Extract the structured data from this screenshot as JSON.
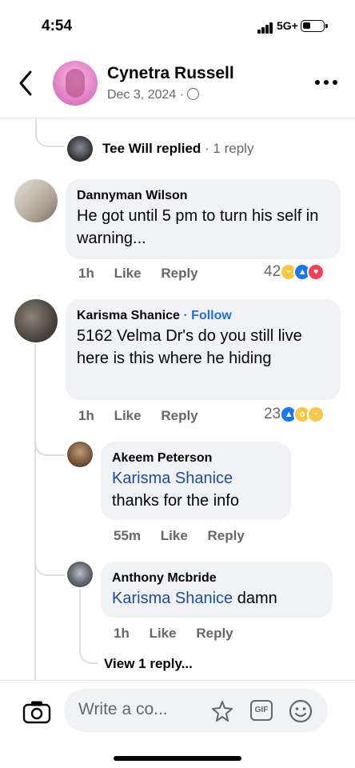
{
  "status_bar": {
    "time": "4:54",
    "network": "5G+",
    "battery_level": 0.3
  },
  "header": {
    "name": "Cynetra Russell",
    "date": "Dec 3, 2024 ·",
    "privacy_icon": "globe-icon",
    "more_icon": "more-icon",
    "back_icon": "back-chevron-icon"
  },
  "thread": {
    "collapsed_reply": {
      "name": "Tee Will replied",
      "meta": "· 1 reply"
    },
    "comments": [
      {
        "author": "Dannyman Wilson",
        "text": "He got until 5 pm to turn his self in warning...",
        "time": "1h",
        "like": "Like",
        "reply": "Reply",
        "reaction_count": "42",
        "reactions": [
          "haha",
          "like",
          "love"
        ]
      },
      {
        "author": "Karisma Shanice",
        "follow": "· Follow",
        "text": "5162 Velma Dr's do you still live here is this where he hiding",
        "time": "1h",
        "like": "Like",
        "reply": "Reply",
        "reaction_count": "23",
        "reactions": [
          "like",
          "wow",
          "haha"
        ],
        "replies": [
          {
            "author": "Akeem Peterson",
            "mention": "Karisma Shanice",
            "text": "thanks for the info",
            "time": "55m",
            "like": "Like",
            "reply": "Reply"
          },
          {
            "author": "Anthony Mcbride",
            "mention": "Karisma Shanice",
            "text": " damn",
            "time": "1h",
            "like": "Like",
            "reply": "Reply"
          }
        ],
        "view_more": "View 1 reply..."
      }
    ]
  },
  "composer": {
    "placeholder": "Write a co...",
    "camera_icon": "camera-icon",
    "sticker_icon": "sticker-icon",
    "gif_label": "GIF",
    "emoji_icon": "emoji-icon"
  },
  "colors": {
    "link": "#216fdb",
    "mention": "#1b4e9b",
    "bubble": "#f0f2f5",
    "secondary_text": "#65676b"
  }
}
